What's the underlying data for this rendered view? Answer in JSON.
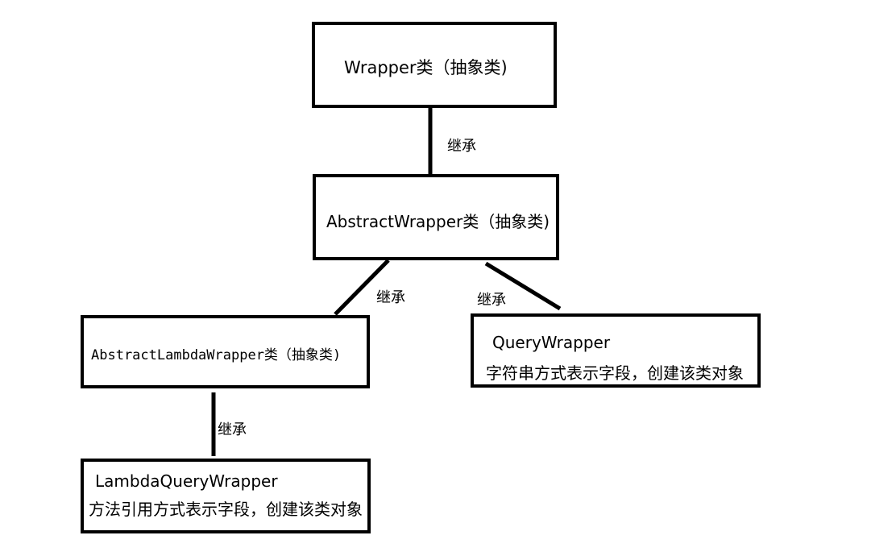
{
  "nodes": {
    "wrapper": {
      "label": "Wrapper类（抽象类)"
    },
    "abstract_wrapper": {
      "label": "AbstractWrapper类（抽象类)"
    },
    "abstract_lambda_wrapper": {
      "label": "AbstractLambdaWrapper类（抽象类)"
    },
    "query_wrapper": {
      "name": "QueryWrapper",
      "description": "字符串方式表示字段，创建该类对象"
    },
    "lambda_query_wrapper": {
      "name": "LambdaQueryWrapper",
      "description": "方法引用方式表示字段，创建该类对象"
    }
  },
  "edges": [
    {
      "from": "abstract_wrapper",
      "to": "wrapper",
      "label": "继承"
    },
    {
      "from": "abstract_lambda_wrapper",
      "to": "abstract_wrapper",
      "label": "继承"
    },
    {
      "from": "query_wrapper",
      "to": "abstract_wrapper",
      "label": "继承"
    },
    {
      "from": "lambda_query_wrapper",
      "to": "abstract_lambda_wrapper",
      "label": "继承"
    }
  ],
  "colors": {
    "line": "#000000",
    "background": "#ffffff"
  }
}
